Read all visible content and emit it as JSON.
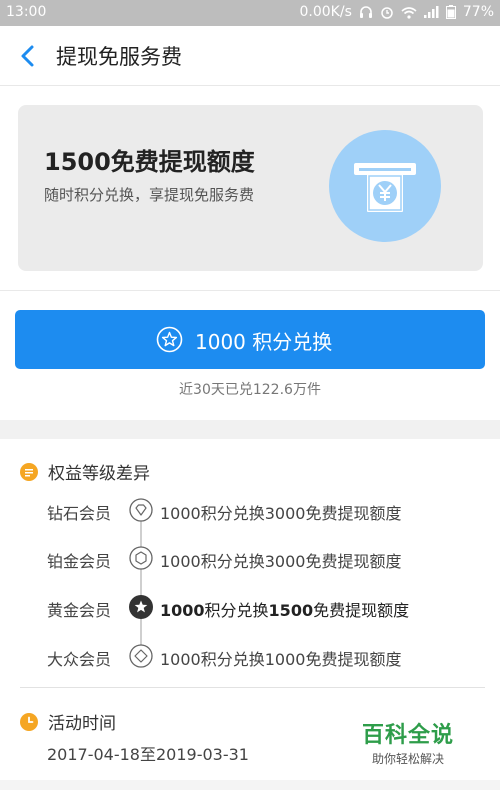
{
  "status_bar": {
    "time": "13:00",
    "speed": "0.00K/s",
    "battery": "77%"
  },
  "header": {
    "title": "提现免服务费"
  },
  "promo_card": {
    "headline": "1500免费提现额度",
    "subtitle": "随时积分兑换，享提现免服务费",
    "accent_color": "#9fd0f8"
  },
  "exchange": {
    "label": "1000 积分兑换",
    "redeemed_text": "近30天已兑122.6万件",
    "button_color": "#1d8cf0"
  },
  "benefits": {
    "title": "权益等级差异",
    "tiers": [
      {
        "name": "钻石会员",
        "desc": "1000积分兑换3000免费提现额度",
        "icon": "diamond-badge-icon",
        "active": false
      },
      {
        "name": "铂金会员",
        "desc": "1000积分兑换3000免费提现额度",
        "icon": "platinum-badge-icon",
        "active": false
      },
      {
        "name": "黄金会员",
        "desc_prefix": "1000",
        "desc_mid": "积分兑换",
        "desc_amount": "1500",
        "desc_suffix": "免费提现额度",
        "icon": "gold-badge-icon",
        "active": true
      },
      {
        "name": "大众会员",
        "desc": "1000积分兑换1000免费提现额度",
        "icon": "public-badge-icon",
        "active": false
      }
    ]
  },
  "activity": {
    "title": "活动时间",
    "dates": "2017-04-18至2019-03-31"
  },
  "watermark": {
    "title": "百科全说",
    "tagline": "助你轻松解决"
  }
}
